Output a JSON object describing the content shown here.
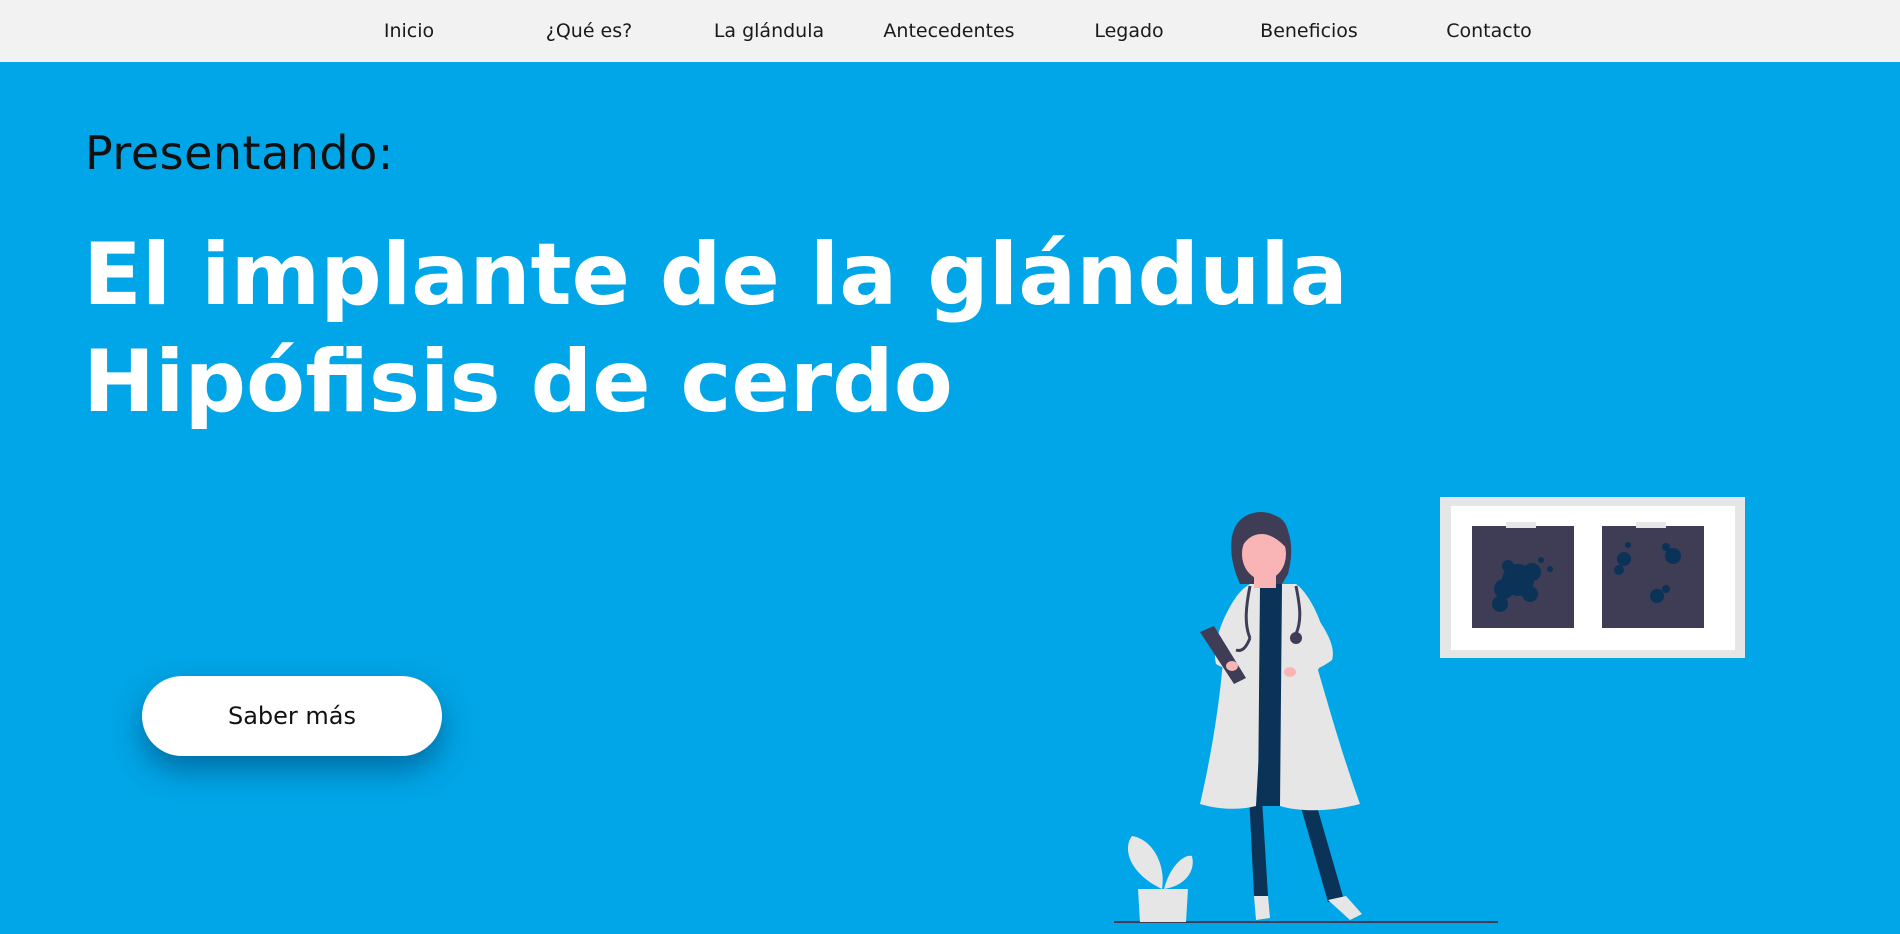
{
  "nav": {
    "items": [
      {
        "label": "Inicio"
      },
      {
        "label": "¿Qué es?"
      },
      {
        "label": "La glándula"
      },
      {
        "label": "Antecedentes"
      },
      {
        "label": "Legado"
      },
      {
        "label": "Beneficios"
      },
      {
        "label": "Contacto"
      }
    ]
  },
  "hero": {
    "intro": "Presentando:",
    "title_line1": "El implante de la glándula",
    "title_line2": "Hipófisis de cerdo",
    "cta_label": "Saber más"
  },
  "colors": {
    "hero_background": "#00a6e7",
    "nav_background": "#f2f2f2",
    "title_text": "#ffffff",
    "button_background": "#ffffff",
    "illustration_dark": "#3f3d56",
    "illustration_navy": "#0b3257",
    "illustration_coat": "#e6e6e6"
  },
  "illustration": {
    "icon": "doctor-illustration"
  }
}
